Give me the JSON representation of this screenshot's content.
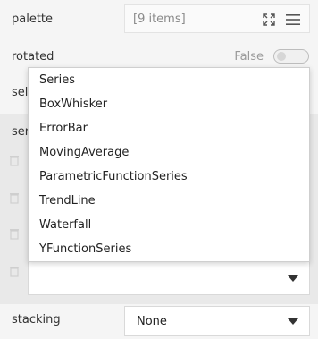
{
  "palette": {
    "label": "palette",
    "items_text": "[9 items]"
  },
  "rotated": {
    "label": "rotated",
    "value_text": "False"
  },
  "partial_labels": {
    "row3": "sel",
    "row4": "ser"
  },
  "dropdown": {
    "options": [
      "Series",
      "BoxWhisker",
      "ErrorBar",
      "MovingAverage",
      "ParametricFunctionSeries",
      "TrendLine",
      "Waterfall",
      "YFunctionSeries"
    ]
  },
  "stacking": {
    "label": "stacking",
    "value": "None"
  },
  "icons": {
    "expand": "expand-icon",
    "menu": "hamburger-menu-icon",
    "trash": "trash-icon",
    "caret": "chevron-down-icon"
  }
}
